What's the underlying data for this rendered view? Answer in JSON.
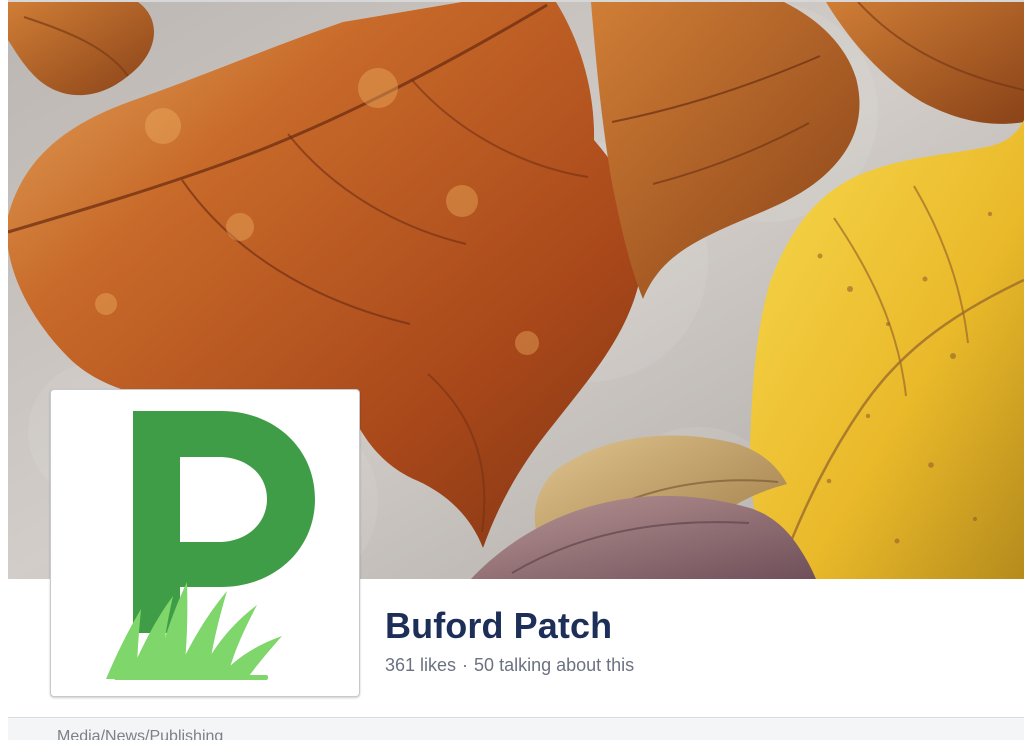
{
  "cover": {
    "image_subject": "autumn leaves on pavement"
  },
  "profile": {
    "logo_letter": "P",
    "logo_color": "#3f9d47",
    "grass_color": "#7fd66a"
  },
  "page": {
    "name": "Buford Patch",
    "likes": "361 likes",
    "separator": "·",
    "talking": "50 talking about this",
    "category": "Media/News/Publishing"
  }
}
